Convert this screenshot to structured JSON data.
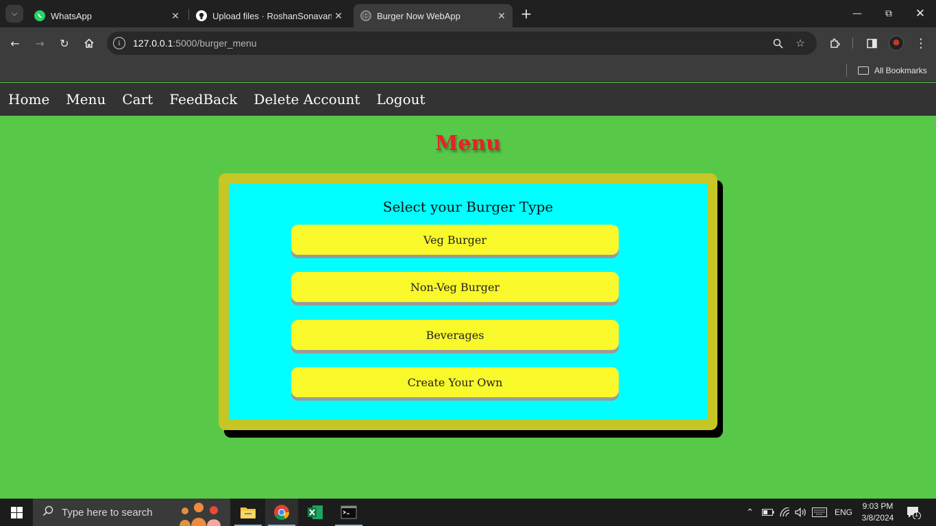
{
  "browser": {
    "tabs": [
      {
        "title": "WhatsApp",
        "icon": "whatsapp-icon",
        "active": false
      },
      {
        "title": "Upload files · RoshanSonavane/",
        "icon": "github-icon",
        "active": false
      },
      {
        "title": "Burger Now WebApp",
        "icon": "globe-icon",
        "active": true
      }
    ],
    "url_host": "127.0.0.1",
    "url_path": ":5000/burger_menu",
    "bookmarks_label": "All Bookmarks"
  },
  "navbar": {
    "items": [
      "Home",
      "Menu",
      "Cart",
      "FeedBack",
      "Delete Account",
      "Logout"
    ]
  },
  "page": {
    "title": "Menu",
    "heading": "Select your Burger Type",
    "buttons": [
      "Veg Burger",
      "Non-Veg Burger",
      "Beverages",
      "Create Your Own"
    ]
  },
  "taskbar": {
    "search_placeholder": "Type here to search",
    "language": "ENG",
    "time": "9:03 PM",
    "date": "3/8/2024",
    "notification_count": "1"
  },
  "colors": {
    "page_bg": "#58c848",
    "navbar_bg": "#333333",
    "title_color": "#e8202a",
    "card_border": "#c6c624",
    "card_bg": "#00ffff",
    "button_bg": "#f8f82a"
  }
}
